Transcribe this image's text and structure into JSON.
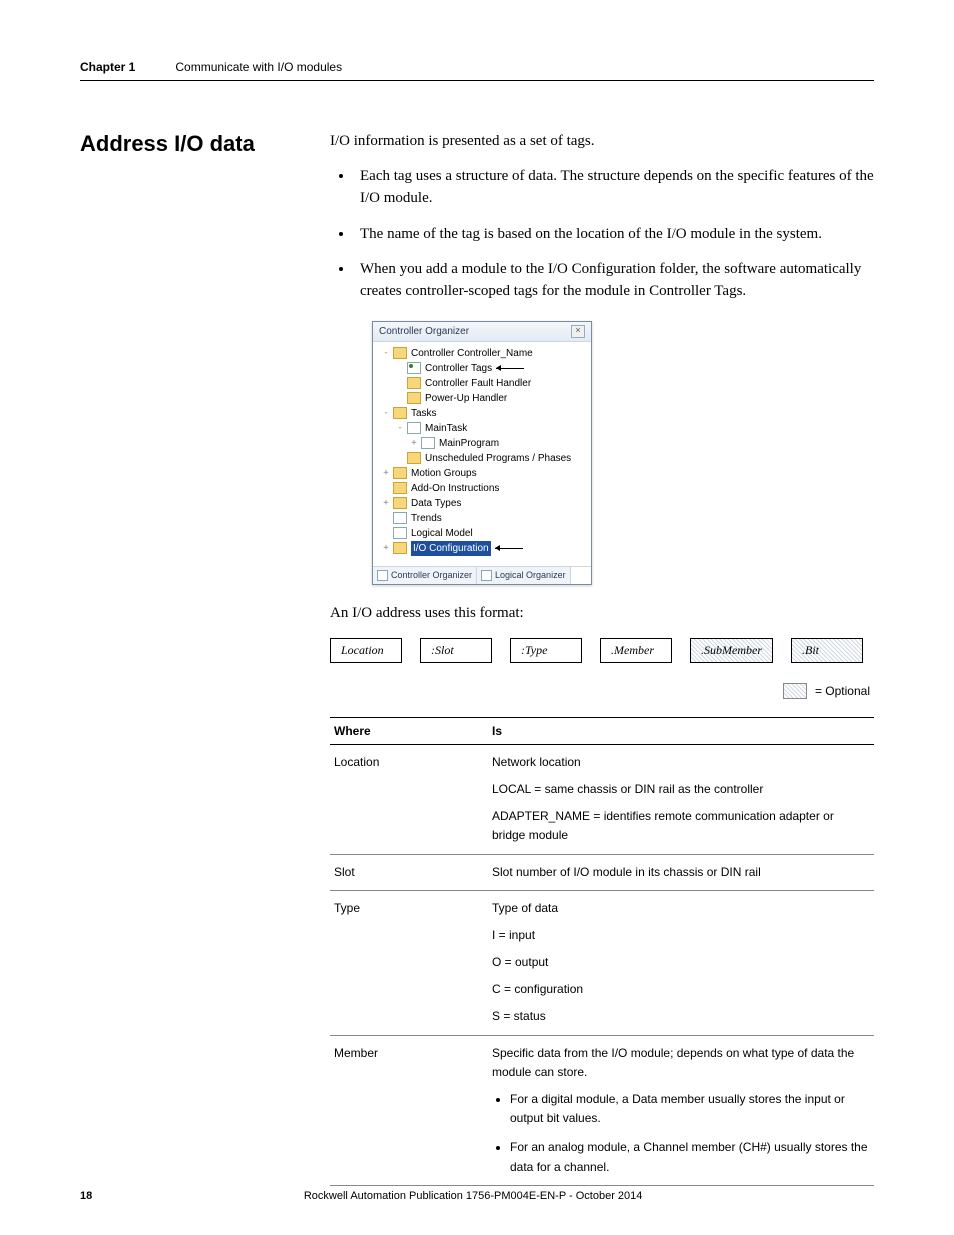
{
  "header": {
    "chapter_label": "Chapter 1",
    "chapter_title": "Communicate with I/O modules"
  },
  "section": {
    "heading": "Address I/O data",
    "intro": "I/O information is presented as a set of tags.",
    "bullets": [
      "Each tag uses a structure of data. The structure depends on the specific features of the I/O module.",
      "The name of the tag is based on the location of the I/O module in the system.",
      "When you add a module to the I/O Configuration folder, the software automatically creates controller-scoped tags for the module in Controller Tags."
    ],
    "format_intro": "An I/O address uses this format:",
    "legend_label": "= Optional"
  },
  "organizer": {
    "title": "Controller Organizer",
    "close_glyph": "×",
    "items": [
      {
        "indent": 0,
        "twisty": "-",
        "icon": "folder-open",
        "label": "Controller Controller_Name"
      },
      {
        "indent": 1,
        "twisty": "",
        "icon": "tags",
        "label": "Controller Tags",
        "arrow": true
      },
      {
        "indent": 1,
        "twisty": "",
        "icon": "closed",
        "label": "Controller Fault Handler"
      },
      {
        "indent": 1,
        "twisty": "",
        "icon": "closed",
        "label": "Power-Up Handler"
      },
      {
        "indent": 0,
        "twisty": "-",
        "icon": "folder-open",
        "label": "Tasks"
      },
      {
        "indent": 1,
        "twisty": "-",
        "icon": "doc",
        "label": "MainTask"
      },
      {
        "indent": 2,
        "twisty": "+",
        "icon": "doc",
        "label": "MainProgram"
      },
      {
        "indent": 1,
        "twisty": "",
        "icon": "closed",
        "label": "Unscheduled Programs / Phases"
      },
      {
        "indent": 0,
        "twisty": "+",
        "icon": "closed",
        "label": "Motion Groups"
      },
      {
        "indent": 0,
        "twisty": "",
        "icon": "closed",
        "label": "Add-On Instructions"
      },
      {
        "indent": 0,
        "twisty": "+",
        "icon": "closed",
        "label": "Data Types"
      },
      {
        "indent": 0,
        "twisty": "",
        "icon": "trends",
        "label": "Trends"
      },
      {
        "indent": 0,
        "twisty": "",
        "icon": "logical",
        "label": "Logical Model"
      },
      {
        "indent": 0,
        "twisty": "+",
        "icon": "ioconf",
        "label": "I/O Configuration",
        "highlight": true,
        "arrow": true
      }
    ],
    "tabs": [
      "Controller Organizer",
      "Logical Organizer"
    ]
  },
  "format_boxes": [
    {
      "label": "Location",
      "optional": false
    },
    {
      "label": ":Slot",
      "optional": false
    },
    {
      "label": ":Type",
      "optional": false
    },
    {
      "label": ".Member",
      "optional": false
    },
    {
      "label": ".SubMember",
      "optional": true
    },
    {
      "label": ".Bit",
      "optional": true
    }
  ],
  "table": {
    "headers": [
      "Where",
      "Is"
    ],
    "rows": [
      {
        "where": "Location",
        "is_lines": [
          "Network location",
          "LOCAL = same chassis or DIN rail as the controller",
          "ADAPTER_NAME = identifies remote communication adapter or bridge module"
        ]
      },
      {
        "where": "Slot",
        "is_lines": [
          "Slot number of I/O module in its chassis or DIN rail"
        ]
      },
      {
        "where": "Type",
        "is_lines": [
          "Type of data",
          "I = input",
          "O = output",
          "C = configuration",
          "S = status"
        ]
      },
      {
        "where": "Member",
        "is_lines": [
          "Specific data from the I/O module; depends on what type of data the module can store."
        ],
        "is_bullets": [
          "For a digital module, a Data member usually stores the input or output bit values.",
          "For an analog module, a Channel member (CH#) usually stores the data for a channel."
        ]
      }
    ]
  },
  "footer": {
    "page_number": "18",
    "publication": "Rockwell Automation Publication 1756-PM004E-EN-P - October 2014"
  }
}
